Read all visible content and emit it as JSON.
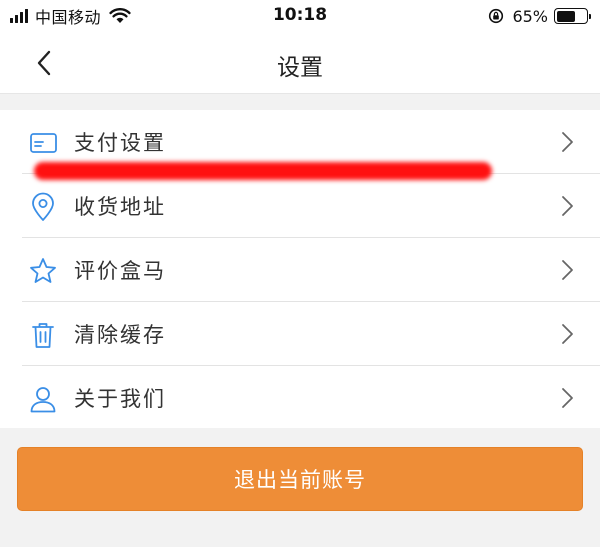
{
  "status_bar": {
    "carrier": "中国移动",
    "time": "10:18",
    "battery_percent": "65%",
    "battery_level": 0.65,
    "icons": [
      "signal-icon",
      "wifi-icon",
      "orientation-lock-icon",
      "battery-icon"
    ]
  },
  "nav": {
    "title": "设置",
    "back_icon": "chevron-left-icon"
  },
  "settings": {
    "items": [
      {
        "label": "支付设置",
        "icon": "card-icon"
      },
      {
        "label": "收货地址",
        "icon": "location-pin-icon"
      },
      {
        "label": "评价盒马",
        "icon": "star-icon"
      },
      {
        "label": "清除缓存",
        "icon": "trash-icon"
      },
      {
        "label": "关于我们",
        "icon": "user-icon"
      }
    ]
  },
  "logout": {
    "label": "退出当前账号"
  },
  "colors": {
    "accent": "#ee8d37",
    "icon_blue": "#3a8ee6",
    "background": "#f2f2f2",
    "redaction": "#ff1010"
  }
}
